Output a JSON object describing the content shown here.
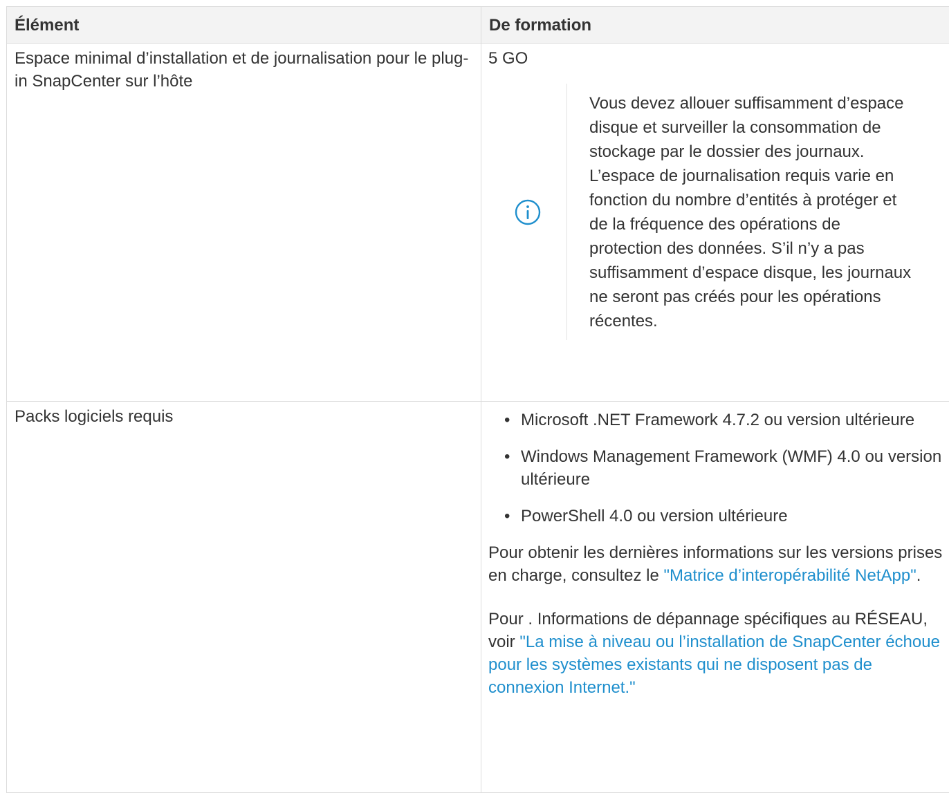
{
  "table": {
    "headers": [
      "Élément",
      "De formation"
    ],
    "rows": [
      {
        "item": "Espace minimal d’installation et de journalisation pour le plug-in SnapCenter sur l’hôte",
        "requirement": {
          "value": "5 GO",
          "note": {
            "icon": "info-icon",
            "text": "Vous devez allouer suffisamment d’espace disque et surveiller la consommation de stockage par le dossier des journaux. L’espace de journalisation requis varie en fonction du nombre d’entités à protéger et de la fréquence des opérations de protection des données. S’il n’y a pas suffisamment d’espace disque, les journaux ne seront pas créés pour les opérations récentes."
          }
        }
      },
      {
        "item": "Packs logiciels requis",
        "requirement": {
          "bullets": [
            "Microsoft .NET Framework 4.7.2 ou version ultérieure",
            "Windows Management Framework (WMF) 4.0 ou version ultérieure",
            "PowerShell 4.0 ou version ultérieure"
          ],
          "para1": {
            "text": "Pour obtenir les dernières informations sur les versions prises en charge, consultez le ",
            "link": "\"Matrice d’interopérabilité NetApp\"",
            "after": "."
          },
          "para2": {
            "text": "Pour . Informations de dépannage spécifiques au RÉSEAU, voir ",
            "link": "\"La mise à niveau ou l’installation de SnapCenter échoue pour les systèmes existants qui ne disposent pas de connexion Internet.\""
          }
        }
      }
    ]
  },
  "colors": {
    "text": "#333333",
    "link": "#1f8fcd",
    "header_bg": "#f3f3f3",
    "border": "#dcdcdc",
    "icon": "#1f8fcd"
  }
}
